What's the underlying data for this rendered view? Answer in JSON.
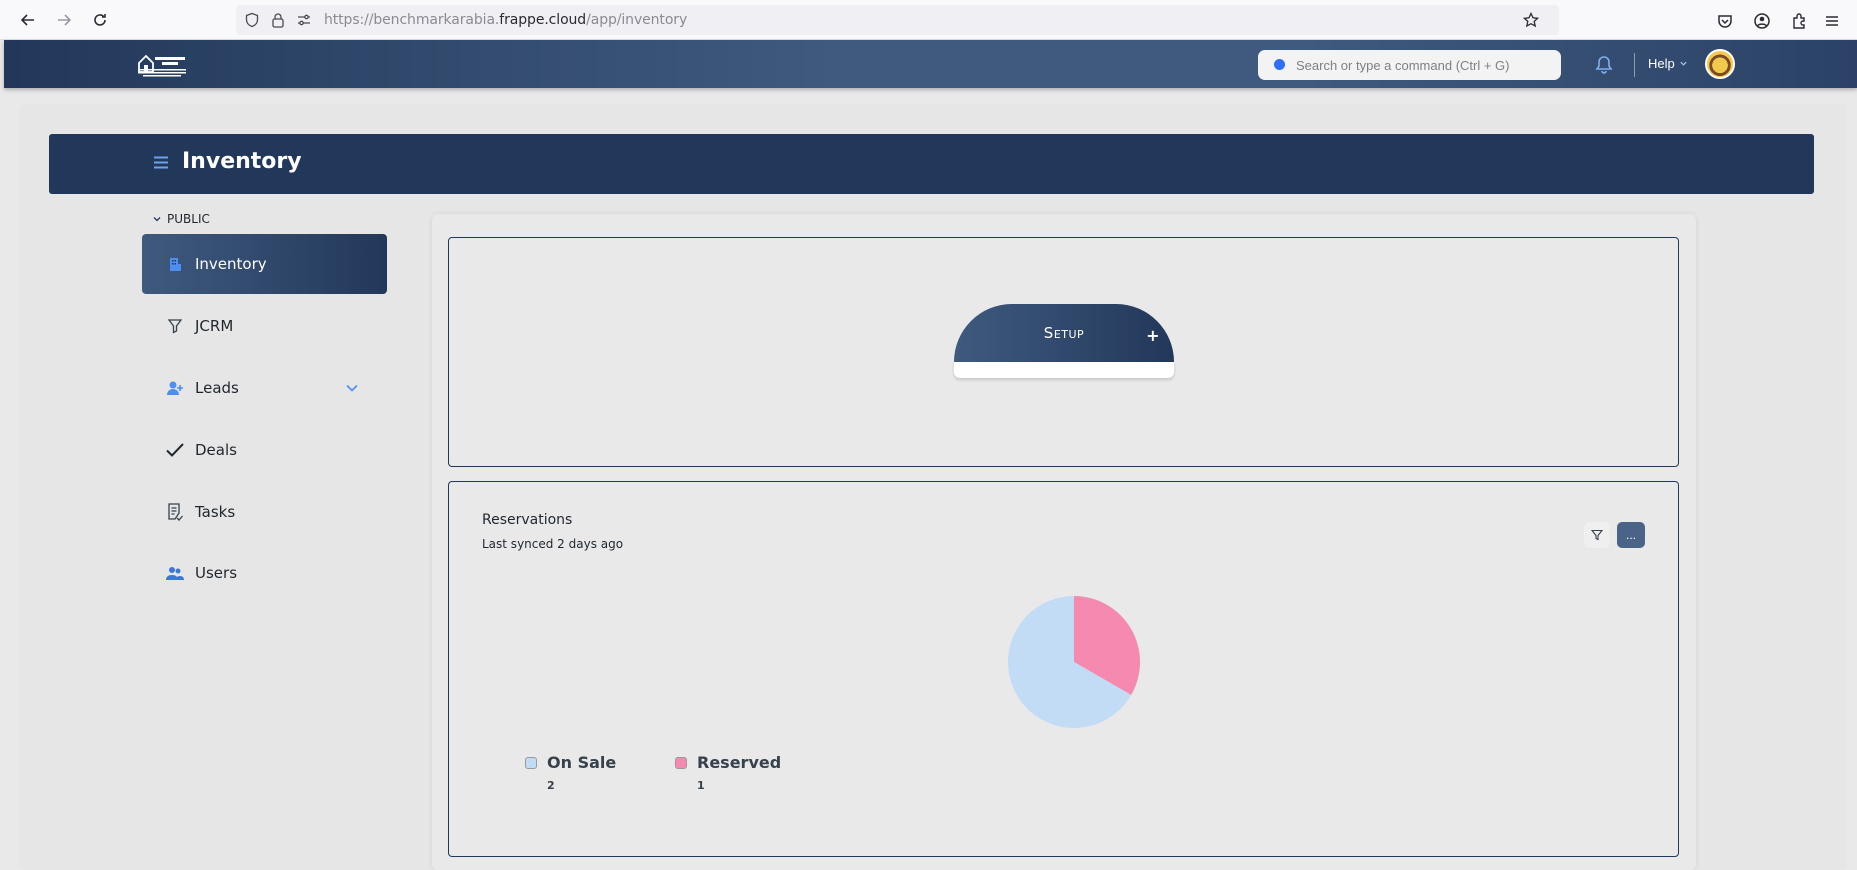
{
  "browser": {
    "url_prefix": "https://benchmarkarabia.",
    "url_host": "frappe.cloud",
    "url_path": "/app/inventory"
  },
  "navbar": {
    "logo_text": "Benchmark Arabia Real Estate Consulting Business Development",
    "search_placeholder": "Search or type a command (Ctrl + G)",
    "help_label": "Help"
  },
  "page": {
    "title": "Inventory"
  },
  "sidebar": {
    "section": "PUBLIC",
    "items": [
      {
        "label": "Inventory",
        "icon": "building-icon",
        "active": true
      },
      {
        "label": "JCRM",
        "icon": "filter-icon"
      },
      {
        "label": "Leads",
        "icon": "user-icon",
        "expandable": true
      },
      {
        "label": "Deals",
        "icon": "check-icon"
      },
      {
        "label": "Tasks",
        "icon": "task-icon"
      },
      {
        "label": "Users",
        "icon": "users-icon"
      }
    ]
  },
  "setup": {
    "label": "Setup",
    "plus": "+"
  },
  "reservations": {
    "title": "Reservations",
    "subtitle": "Last synced 2 days ago",
    "more_label": "..."
  },
  "colors": {
    "primary": "#22385a",
    "accent": "#3f5a7e",
    "on_sale": "#c2dcf5",
    "reserved": "#f589b0"
  },
  "chart_data": {
    "type": "pie",
    "categories": [
      "On Sale",
      "Reserved"
    ],
    "values": [
      2,
      1
    ],
    "colors": [
      "#c2dcf5",
      "#f589b0"
    ],
    "legend": "bottom"
  }
}
